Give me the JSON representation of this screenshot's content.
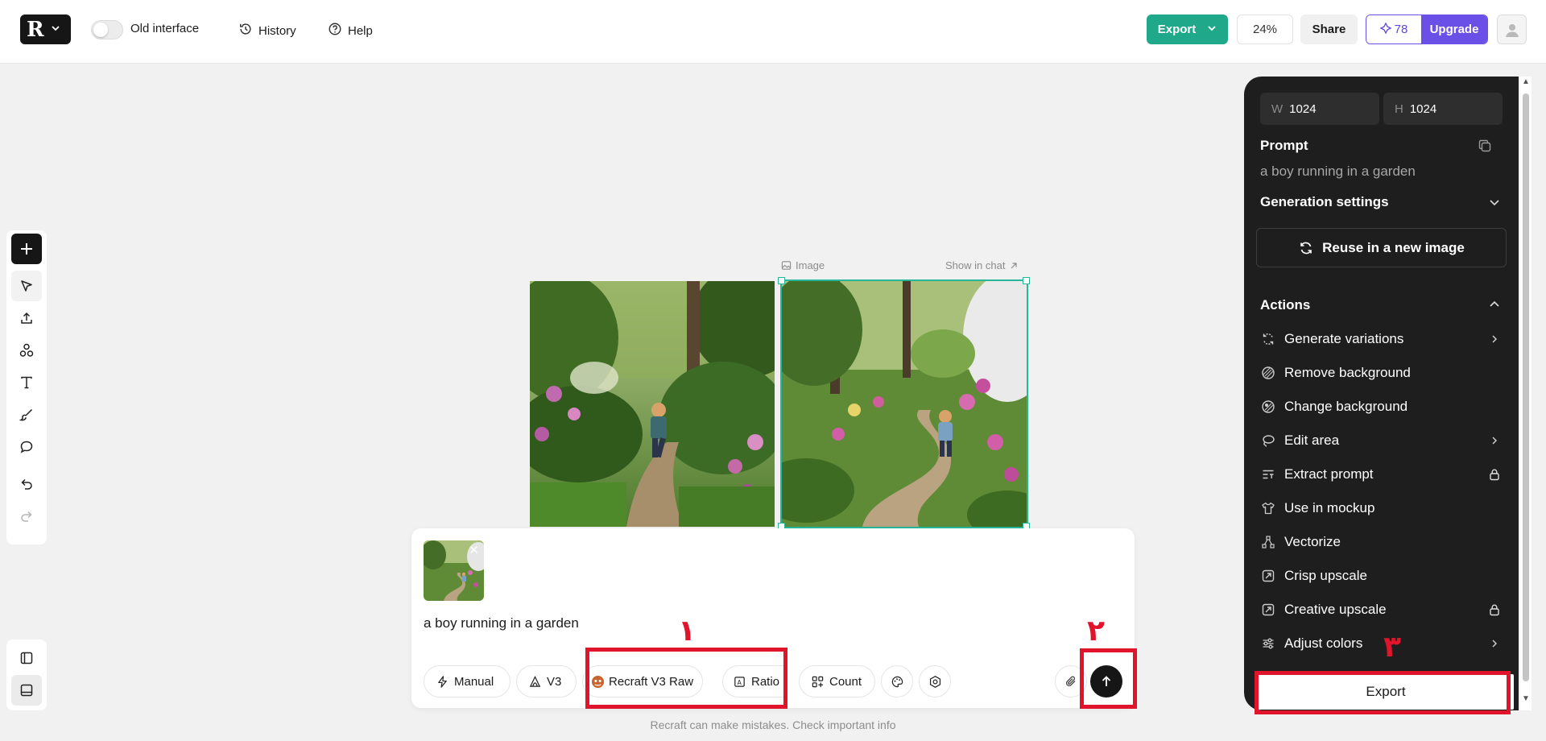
{
  "topbar": {
    "logo_menu_icon": "chevron-down-icon",
    "old_interface_label": "Old interface",
    "history_label": "History",
    "help_label": "Help",
    "export_label": "Export",
    "zoom": "24%",
    "share_label": "Share",
    "credits": "78",
    "upgrade_label": "Upgrade"
  },
  "canvas": {
    "image_label": "Image",
    "show_in_chat_label": "Show in chat"
  },
  "chat": {
    "prompt": "a boy running in a garden",
    "chips": {
      "manual": "Manual",
      "version": "V3",
      "style": "Recraft V3 Raw",
      "ratio": "Ratio",
      "count": "Count"
    },
    "disclaimer": "Recraft can make mistakes. Check important info"
  },
  "panel": {
    "width_key": "W",
    "width_value": "1024",
    "height_key": "H",
    "height_value": "1024",
    "prompt_title": "Prompt",
    "prompt_value": "a boy running in a garden",
    "generation_settings": "Generation settings",
    "reuse_label": "Reuse in a new image",
    "actions_title": "Actions",
    "actions": [
      {
        "label": "Generate variations",
        "trail": "chevron-right"
      },
      {
        "label": "Remove background",
        "trail": ""
      },
      {
        "label": "Change background",
        "trail": ""
      },
      {
        "label": "Edit area",
        "trail": "chevron-right"
      },
      {
        "label": "Extract prompt",
        "trail": "lock"
      },
      {
        "label": "Use in mockup",
        "trail": ""
      },
      {
        "label": "Vectorize",
        "trail": ""
      },
      {
        "label": "Crisp upscale",
        "trail": ""
      },
      {
        "label": "Creative upscale",
        "trail": "lock"
      },
      {
        "label": "Adjust colors",
        "trail": "chevron-right"
      }
    ],
    "export_label": "Export"
  },
  "annotations": {
    "one": "١",
    "two": "٢",
    "three": "٣"
  },
  "colors": {
    "accent_green": "#1fa98a",
    "upgrade_purple": "#6a50e6",
    "annotation_red": "#e0142b",
    "panel_dark": "#1e1e1e"
  }
}
